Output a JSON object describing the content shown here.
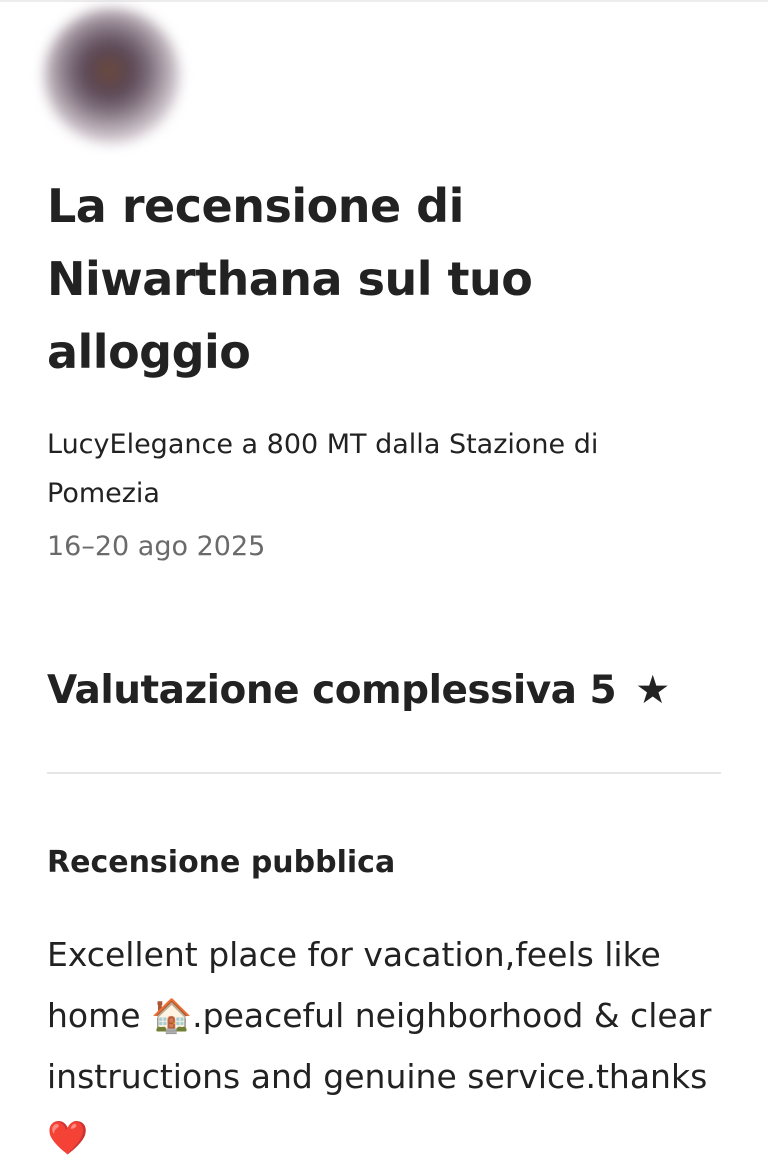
{
  "review": {
    "title": "La recensione di Niwarthana sul tuo alloggio",
    "listing_name": "LucyElegance a 800 MT dalla Stazione di Pomezia",
    "stay_dates": "16–20 ago 2025",
    "overall_rating_label": "Valutazione complessiva",
    "overall_rating_value": "5",
    "rating_star": "★",
    "public_review_heading": "Recensione pubblica",
    "public_review_text": "Excellent place for vacation,feels like home 🏠.peaceful neighborhood & clear instructions and genuine service.thanks ❤️"
  },
  "icons": {
    "avatar": "reviewer-avatar-blurred",
    "rating_star": "star-icon"
  },
  "colors": {
    "primary_text": "#222222",
    "secondary_text": "#6a6a6a",
    "divider": "#e6e6e6",
    "background": "#ffffff"
  }
}
